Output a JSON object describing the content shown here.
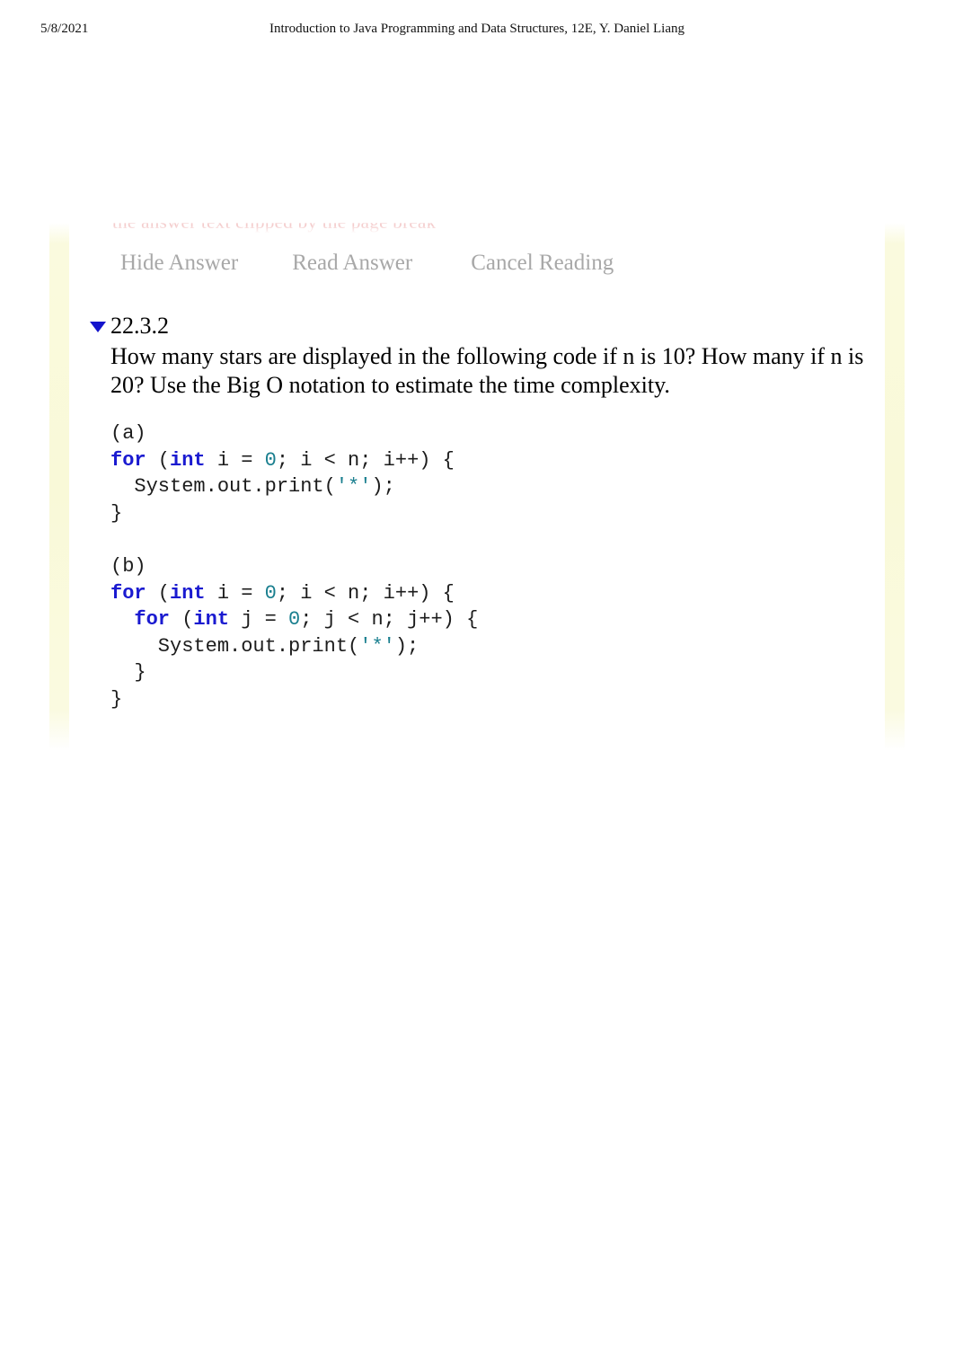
{
  "page_header": {
    "date": "5/8/2021",
    "title": "Introduction to Java Programming and Data Structures, 12E, Y. Daniel Liang"
  },
  "clipped_preview": {
    "text": "the answer text clipped by the page break"
  },
  "answer_controls": {
    "hide_label": "Hide Answer",
    "read_label": "Read Answer",
    "cancel_label": "Cancel Reading"
  },
  "exercise": {
    "toggle_state": "expanded",
    "number": "22.3.2",
    "question": "How many stars are displayed in the following code if n is 10? How many if n is 20? Use the Big O notation to estimate the time complexity.",
    "code_blocks": [
      {
        "label": "(a)",
        "lines": [
          [
            {
              "t": "(a)",
              "c": "plain"
            }
          ],
          [
            {
              "t": "for",
              "c": "keyword"
            },
            {
              "t": " (",
              "c": "plain"
            },
            {
              "t": "int",
              "c": "keyword"
            },
            {
              "t": " i = ",
              "c": "plain"
            },
            {
              "t": "0",
              "c": "number"
            },
            {
              "t": "; i < n; i++) {",
              "c": "plain"
            }
          ],
          [
            {
              "t": "  System.out.print(",
              "c": "plain"
            },
            {
              "t": "'*'",
              "c": "string"
            },
            {
              "t": ");",
              "c": "plain"
            }
          ],
          [
            {
              "t": "}",
              "c": "plain"
            }
          ]
        ]
      },
      {
        "label": "(b)",
        "lines": [
          [
            {
              "t": "(b)",
              "c": "plain"
            }
          ],
          [
            {
              "t": "for",
              "c": "keyword"
            },
            {
              "t": " (",
              "c": "plain"
            },
            {
              "t": "int",
              "c": "keyword"
            },
            {
              "t": " i = ",
              "c": "plain"
            },
            {
              "t": "0",
              "c": "number"
            },
            {
              "t": "; i < n; i++) {",
              "c": "plain"
            }
          ],
          [
            {
              "t": "  ",
              "c": "plain"
            },
            {
              "t": "for",
              "c": "keyword"
            },
            {
              "t": " (",
              "c": "plain"
            },
            {
              "t": "int",
              "c": "keyword"
            },
            {
              "t": " j = ",
              "c": "plain"
            },
            {
              "t": "0",
              "c": "number"
            },
            {
              "t": "; j < n; j++) {",
              "c": "plain"
            }
          ],
          [
            {
              "t": "    System.out.print(",
              "c": "plain"
            },
            {
              "t": "'*'",
              "c": "string"
            },
            {
              "t": ");",
              "c": "plain"
            }
          ],
          [
            {
              "t": "  }",
              "c": "plain"
            }
          ],
          [
            {
              "t": "}",
              "c": "plain"
            }
          ]
        ]
      }
    ]
  },
  "colors": {
    "keyword": "#1a1ad0",
    "number": "#1a7f8f",
    "string": "#1a7f8f",
    "code_plain": "#1c1c1c",
    "control_label": "#a8a8a8",
    "toggle_triangle": "#1414cc",
    "gutter": "#f9f9d8",
    "clipped_preview": "#e27878"
  }
}
